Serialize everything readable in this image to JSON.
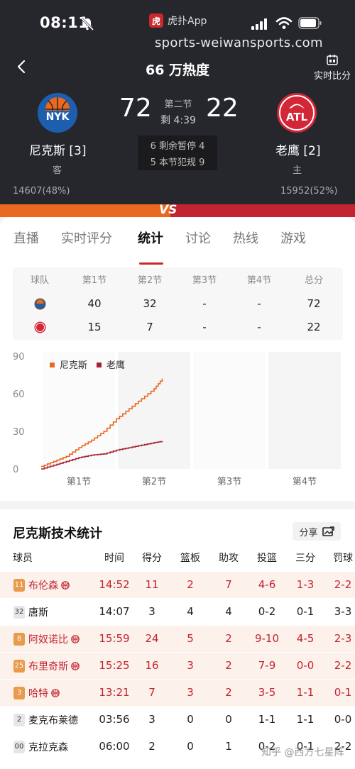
{
  "status": {
    "time": "08:11",
    "app": "虎扑App",
    "app_logo": "虎"
  },
  "watermark": "sports-weiwansports.com",
  "header": {
    "title": "66 万热度",
    "realtime_label": "实时比分"
  },
  "game": {
    "home": {
      "name": "尼克斯 [3]",
      "logo_text": "NYK",
      "side": "客",
      "score": "72",
      "support": "14607(48%)"
    },
    "away": {
      "name": "老鹰 [2]",
      "logo_text": "ATL",
      "side": "主",
      "score": "22",
      "support": "15952(52%)"
    },
    "period": "第二节",
    "clock": "剩 4:39",
    "timeouts": "6 剩余暂停 4",
    "fouls": "5 本节犯规 9",
    "support_bar": {
      "home_pct": 48,
      "away_pct": 52
    },
    "vs": "VS"
  },
  "tabs": [
    "直播",
    "实时评分",
    "统计",
    "讨论",
    "热线",
    "游戏"
  ],
  "score_table": {
    "headers": [
      "球队",
      "第1节",
      "第2节",
      "第3节",
      "第4节",
      "总分"
    ],
    "rows": [
      {
        "team": "NYK",
        "q": [
          "40",
          "32",
          "-",
          "-",
          "72"
        ]
      },
      {
        "team": "ATL",
        "q": [
          "15",
          "7",
          "-",
          "-",
          "22"
        ]
      }
    ]
  },
  "chart_data": {
    "type": "line",
    "xlabel": "",
    "ylabel": "",
    "ylim": [
      0,
      90
    ],
    "yticks": [
      "90",
      "60",
      "30",
      "0"
    ],
    "xticks": [
      "第1节",
      "第2节",
      "第3节",
      "第4节"
    ],
    "legend": "top-left",
    "series": [
      {
        "name": "尼克斯",
        "color": "#e8691f",
        "x": [
          0,
          2,
          4,
          6,
          8,
          10,
          12,
          14,
          16,
          18,
          19.3
        ],
        "y": [
          2,
          6,
          10,
          17,
          23,
          30,
          40,
          48,
          56,
          64,
          72
        ]
      },
      {
        "name": "老鹰",
        "color": "#a52232",
        "x": [
          0,
          2,
          4,
          6,
          8,
          10,
          12,
          14,
          16,
          18,
          19.3
        ],
        "y": [
          0,
          3,
          6,
          9,
          11,
          12,
          15,
          17,
          19,
          21,
          22
        ]
      }
    ]
  },
  "stats": {
    "title": "尼克斯技术统计",
    "share": "分享",
    "headers": [
      "球员",
      "时间",
      "得分",
      "篮板",
      "助攻",
      "投篮",
      "三分",
      "罚球"
    ],
    "players": [
      {
        "num": "11",
        "name": "布伦森",
        "starter": true,
        "vals": [
          "14:52",
          "11",
          "2",
          "7",
          "4-6",
          "1-3",
          "2-2"
        ]
      },
      {
        "num": "32",
        "name": "唐斯",
        "starter": false,
        "vals": [
          "14:07",
          "3",
          "4",
          "4",
          "0-2",
          "0-1",
          "3-3"
        ]
      },
      {
        "num": "8",
        "name": "阿奴诺比",
        "starter": true,
        "vals": [
          "15:59",
          "24",
          "5",
          "2",
          "9-10",
          "4-5",
          "2-3"
        ]
      },
      {
        "num": "25",
        "name": "布里奇斯",
        "starter": true,
        "vals": [
          "15:25",
          "16",
          "3",
          "2",
          "7-9",
          "0-0",
          "2-2"
        ]
      },
      {
        "num": "3",
        "name": "哈特",
        "starter": true,
        "vals": [
          "13:21",
          "7",
          "3",
          "2",
          "3-5",
          "1-1",
          "0-1"
        ]
      },
      {
        "num": "2",
        "name": "麦克布莱德",
        "starter": false,
        "vals": [
          "03:56",
          "3",
          "0",
          "0",
          "1-1",
          "1-1",
          "0-0"
        ]
      },
      {
        "num": "00",
        "name": "克拉克森",
        "starter": false,
        "vals": [
          "06:00",
          "2",
          "0",
          "1",
          "0-2",
          "0-1",
          "2-2"
        ]
      }
    ]
  },
  "footer_watermark": "知乎 @西方七星阵",
  "colors": {
    "accent": "#c9282d",
    "nyk": "#e8691f",
    "atl": "#c32530",
    "header_bg": "#26272c"
  }
}
